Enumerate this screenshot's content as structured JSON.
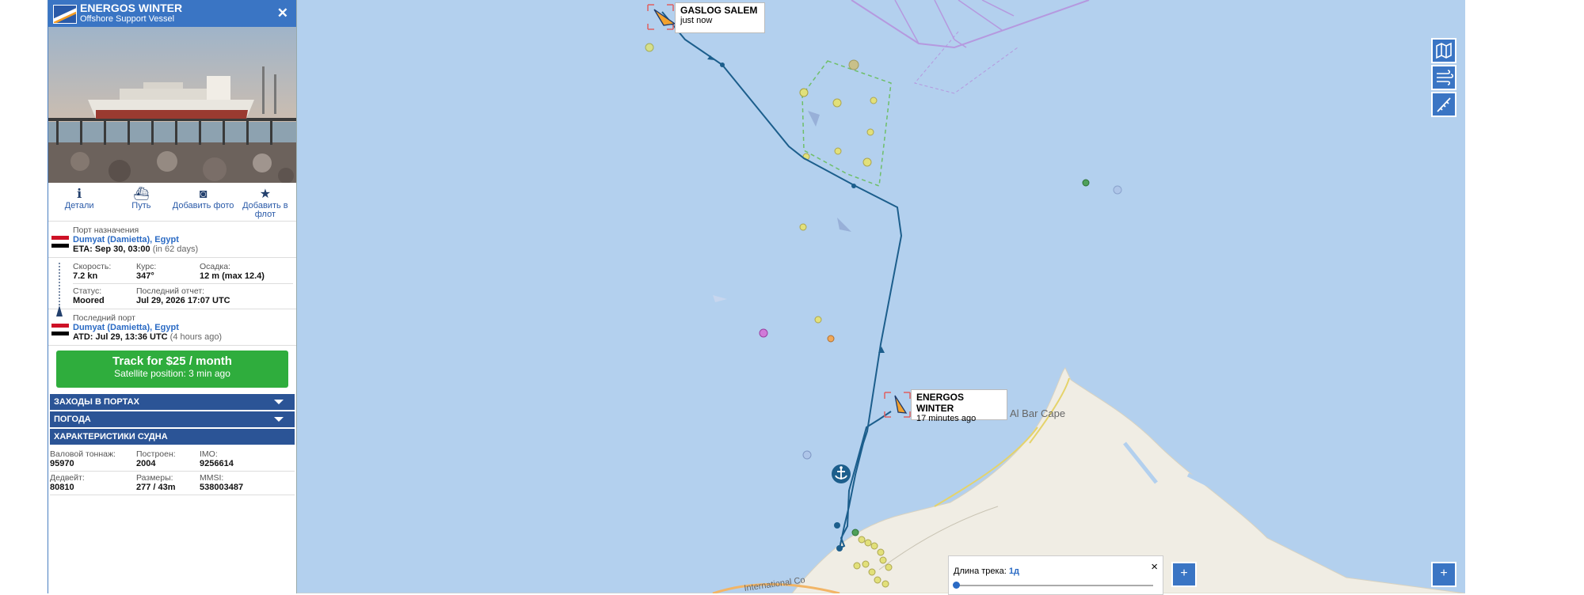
{
  "vessel": {
    "name": "ENERGOS WINTER",
    "type": "Offshore Support Vessel",
    "close_icon": "close-icon"
  },
  "actions": [
    {
      "label": "Детали",
      "icon": "info-icon"
    },
    {
      "label": "Путь",
      "icon": "ship-icon"
    },
    {
      "label": "Добавить фото",
      "icon": "camera-icon"
    },
    {
      "label": "Добавить в флот",
      "icon": "star-icon"
    }
  ],
  "destination": {
    "label": "Порт назначения",
    "port": "Dumyat (Damietta), Egypt",
    "eta_label": "ETA: Sep 30, 03:00",
    "eta_rel": "(in 62 days)"
  },
  "speed": {
    "speed_label": "Скорость:",
    "speed": "7.2 kn",
    "course_label": "Курс:",
    "course": "347°",
    "draught_label": "Осадка:",
    "draught": "12 m (max 12.4)",
    "status_label": "Статус:",
    "status": "Moored",
    "report_label": "Последний отчет:",
    "report": "Jul 29, 2026 17:07 UTC"
  },
  "last_port": {
    "label": "Последний порт",
    "port": "Dumyat (Damietta), Egypt",
    "atd_label": "ATD: Jul 29, 13:36 UTC",
    "atd_rel": "(4 hours ago)"
  },
  "track_button": {
    "title": "Track for $25 / month",
    "subtitle": "Satellite position: 3 min ago"
  },
  "accordions": [
    {
      "label": "ЗАХОДЫ В ПОРТАХ"
    },
    {
      "label": "ПОГОДА"
    },
    {
      "label": "ХАРАКТЕРИСТИКИ СУДНА"
    }
  ],
  "facts": {
    "gt_label": "Валовой тоннаж:",
    "gt": "95970",
    "built_label": "Построен:",
    "built": "2004",
    "imo_label": "IMO:",
    "imo": "9256614",
    "dwt_label": "Дедвейт:",
    "dwt": "80810",
    "size_label": "Размеры:",
    "size": "277 / 43m",
    "mmsi_label": "MMSI:",
    "mmsi": "538003487"
  },
  "map": {
    "vessel1": {
      "name": "GASLOG SALEM",
      "time": "just now"
    },
    "vessel2": {
      "name": "ENERGOS WINTER",
      "time": "17 minutes ago"
    },
    "place": "Al Bar Cape",
    "road": "International Co",
    "buttons": [
      "map-layers-icon",
      "wind-icon",
      "measure-icon"
    ],
    "zoom_in": "+"
  },
  "track_panel": {
    "label": "Длина трека:",
    "value": "1д",
    "close": "×",
    "plus": "+"
  },
  "colors": {
    "sea": "#b3d0ee",
    "land": "#f0ede4",
    "track": "#1c5e8c",
    "panel_blue": "#2b5496",
    "button_green": "#2fad3d"
  }
}
